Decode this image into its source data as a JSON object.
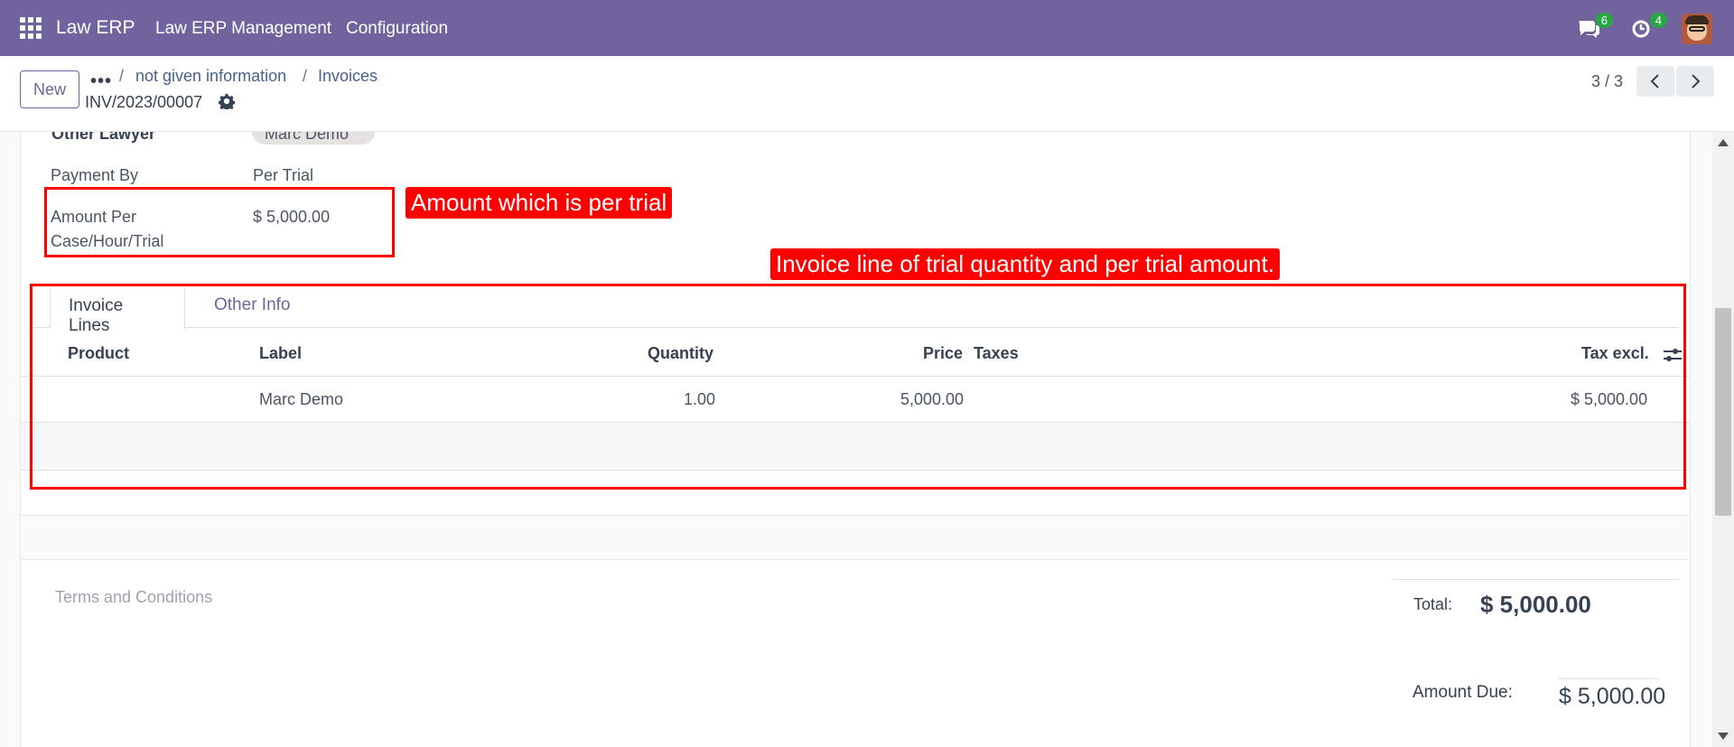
{
  "navbar": {
    "brand": "Law ERP",
    "menus": [
      "Law ERP Management",
      "Configuration"
    ],
    "messages_badge": "6",
    "activities_badge": "4",
    "accent_color": "#71639e"
  },
  "control_panel": {
    "new_label": "New",
    "breadcrumbs": [
      "not given information",
      "Invoices"
    ],
    "record_name": "INV/2023/00007",
    "pager": "3 / 3"
  },
  "form": {
    "other_lawyer_tag": "Marc Demo",
    "payment_by_label": "Payment By",
    "payment_by_value": "Per Trial",
    "amount_label_line1": "Amount Per",
    "amount_label_line2": "Case/Hour/Trial",
    "amount_value": "$ 5,000.00"
  },
  "annotations": {
    "amount_note": "Amount which is per trial",
    "lines_note": "Invoice line of trial quantity and per trial amount."
  },
  "tabs": [
    "Invoice Lines",
    "Other Info"
  ],
  "table": {
    "headers": [
      "Product",
      "Label",
      "Quantity",
      "Price",
      "Taxes",
      "Tax excl."
    ],
    "rows": [
      {
        "product": "",
        "label": "Marc Demo",
        "quantity": "1.00",
        "price": "5,000.00",
        "taxes": "",
        "tax_excl": "$ 5,000.00"
      }
    ]
  },
  "footer": {
    "terms_placeholder": "Terms and Conditions",
    "total_label": "Total:",
    "total_value": "$ 5,000.00",
    "amount_due_label": "Amount Due:",
    "amount_due_value": "$ 5,000.00"
  }
}
